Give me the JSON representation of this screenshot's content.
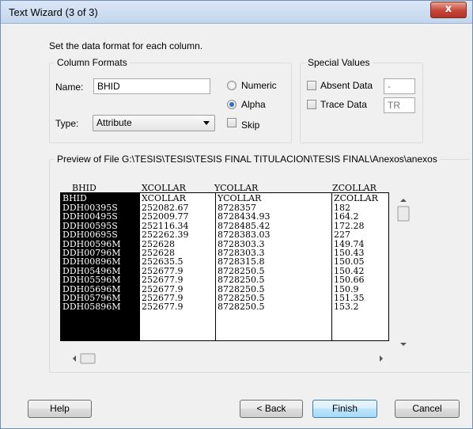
{
  "window": {
    "title": "Text Wizard (3 of 3)",
    "close_glyph": "x"
  },
  "instruction": "Set the data format for each column.",
  "column_formats": {
    "label": "Column Formats",
    "name_label": "Name:",
    "name_value": "BHID",
    "type_label": "Type:",
    "type_value": "Attribute",
    "numeric_label": "Numeric",
    "alpha_label": "Alpha",
    "skip_label": "Skip",
    "selected": "Alpha"
  },
  "special_values": {
    "label": "Special Values",
    "absent_label": "Absent Data",
    "absent_value": "-",
    "trace_label": "Trace Data",
    "trace_value": "TR"
  },
  "preview": {
    "label": "Preview of File G:\\TESIS\\TESIS\\TESIS FINAL TITULACION\\TESIS FINAL\\Anexos\\anexos",
    "headers": [
      "BHID",
      "XCOLLAR",
      "YCOLLAR",
      "ZCOLLAR"
    ],
    "rows": [
      [
        "BHID",
        "XCOLLAR",
        "YCOLLAR",
        "ZCOLLAR"
      ],
      [
        "DDH00395S",
        "252082.67",
        "8728357",
        "182"
      ],
      [
        "DDH00495S",
        "252009.77",
        "8728434.93",
        "164.2"
      ],
      [
        "DDH00595S",
        "252116.34",
        "8728485.42",
        "172.28"
      ],
      [
        "DDH00695S",
        "252262.39",
        "8728383.03",
        "227"
      ],
      [
        "DDH00596M",
        "252628",
        "8728303.3",
        "149.74"
      ],
      [
        "DDH00796M",
        "252628",
        "8728303.3",
        "150.43"
      ],
      [
        "DDH00896M",
        "252635.5",
        "8728315.8",
        "150.05"
      ],
      [
        "DDH05496M",
        "252677.9",
        "8728250.5",
        "150.42"
      ],
      [
        "DDH05596M",
        "252677.9",
        "8728250.5",
        "150.66"
      ],
      [
        "DDH05696M",
        "252677.9",
        "8728250.5",
        "150.9"
      ],
      [
        "DDH05796M",
        "252677.9",
        "8728250.5",
        "151.35"
      ],
      [
        "DDH05896M",
        "252677.9",
        "8728250.5",
        "153.2"
      ]
    ]
  },
  "buttons": {
    "help": "Help",
    "back": "< Back",
    "finish": "Finish",
    "cancel": "Cancel"
  },
  "icons": {
    "radio_checked_color": "#2b6fc6",
    "close_color": "#c6463a"
  }
}
